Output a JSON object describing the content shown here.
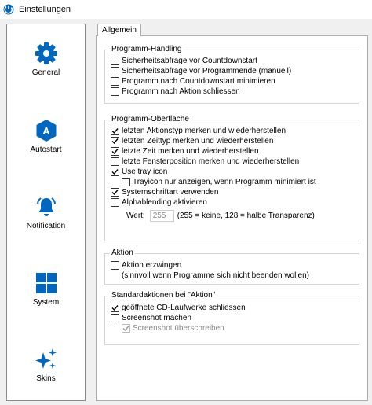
{
  "window": {
    "title": "Einstellungen"
  },
  "sidebar": {
    "items": [
      {
        "id": "general",
        "label": "General",
        "icon": "gear-icon"
      },
      {
        "id": "autostart",
        "label": "Autostart",
        "icon": "autostart-a-icon"
      },
      {
        "id": "notification",
        "label": "Notification",
        "icon": "bell-icon"
      },
      {
        "id": "system",
        "label": "System",
        "icon": "windows-icon"
      },
      {
        "id": "skins",
        "label": "Skins",
        "icon": "sparkles-icon"
      }
    ]
  },
  "tab": {
    "label": "Allgemein"
  },
  "groups": {
    "programm_handling": {
      "title": "Programm-Handling",
      "options": [
        {
          "label": "Sicherheitsabfrage vor Countdownstart",
          "checked": false
        },
        {
          "label": "Sicherheitsabfrage vor Programmende (manuell)",
          "checked": false
        },
        {
          "label": "Programm nach Countdownstart minimieren",
          "checked": false
        },
        {
          "label": "Programm nach Aktion schliessen",
          "checked": false
        }
      ]
    },
    "programm_oberflaeche": {
      "title": "Programm-Oberfläche",
      "options": [
        {
          "label": "letzten Aktionstyp merken und wiederherstellen",
          "checked": true
        },
        {
          "label": "letzten Zeittyp merken und wiederherstellen",
          "checked": true
        },
        {
          "label": "letzte Zeit merken und wiederherstellen",
          "checked": true
        },
        {
          "label": "letzte Fensterposition merken und wiederherstellen",
          "checked": false
        },
        {
          "label": "Use tray icon",
          "checked": true
        },
        {
          "label": "Trayicon nur anzeigen, wenn Programm minimiert ist",
          "checked": false
        },
        {
          "label": "Systemschriftart verwenden",
          "checked": true
        },
        {
          "label": "Alphablending aktivieren",
          "checked": false
        }
      ],
      "wert_label": "Wert:",
      "wert_value": "255",
      "wert_hint": "(255 = keine, 128 = halbe Transparenz)"
    },
    "aktion": {
      "title": "Aktion",
      "option_label": "Aktion erzwingen",
      "option_checked": false,
      "option_note": "(sinnvoll wenn Programme sich nicht beenden wollen)"
    },
    "standardaktionen": {
      "title": "Standardaktionen bei \"Aktion\"",
      "options": [
        {
          "label": "geöffnete CD-Laufwerke schliessen",
          "checked": true
        },
        {
          "label": "Screenshot machen",
          "checked": false
        },
        {
          "label": "Screenshot überschreiben",
          "checked": true,
          "disabled": true
        }
      ]
    }
  },
  "colors": {
    "accent": "#0067c0",
    "checkbox_border": "#333333",
    "disabled": "#8a8a8a"
  }
}
